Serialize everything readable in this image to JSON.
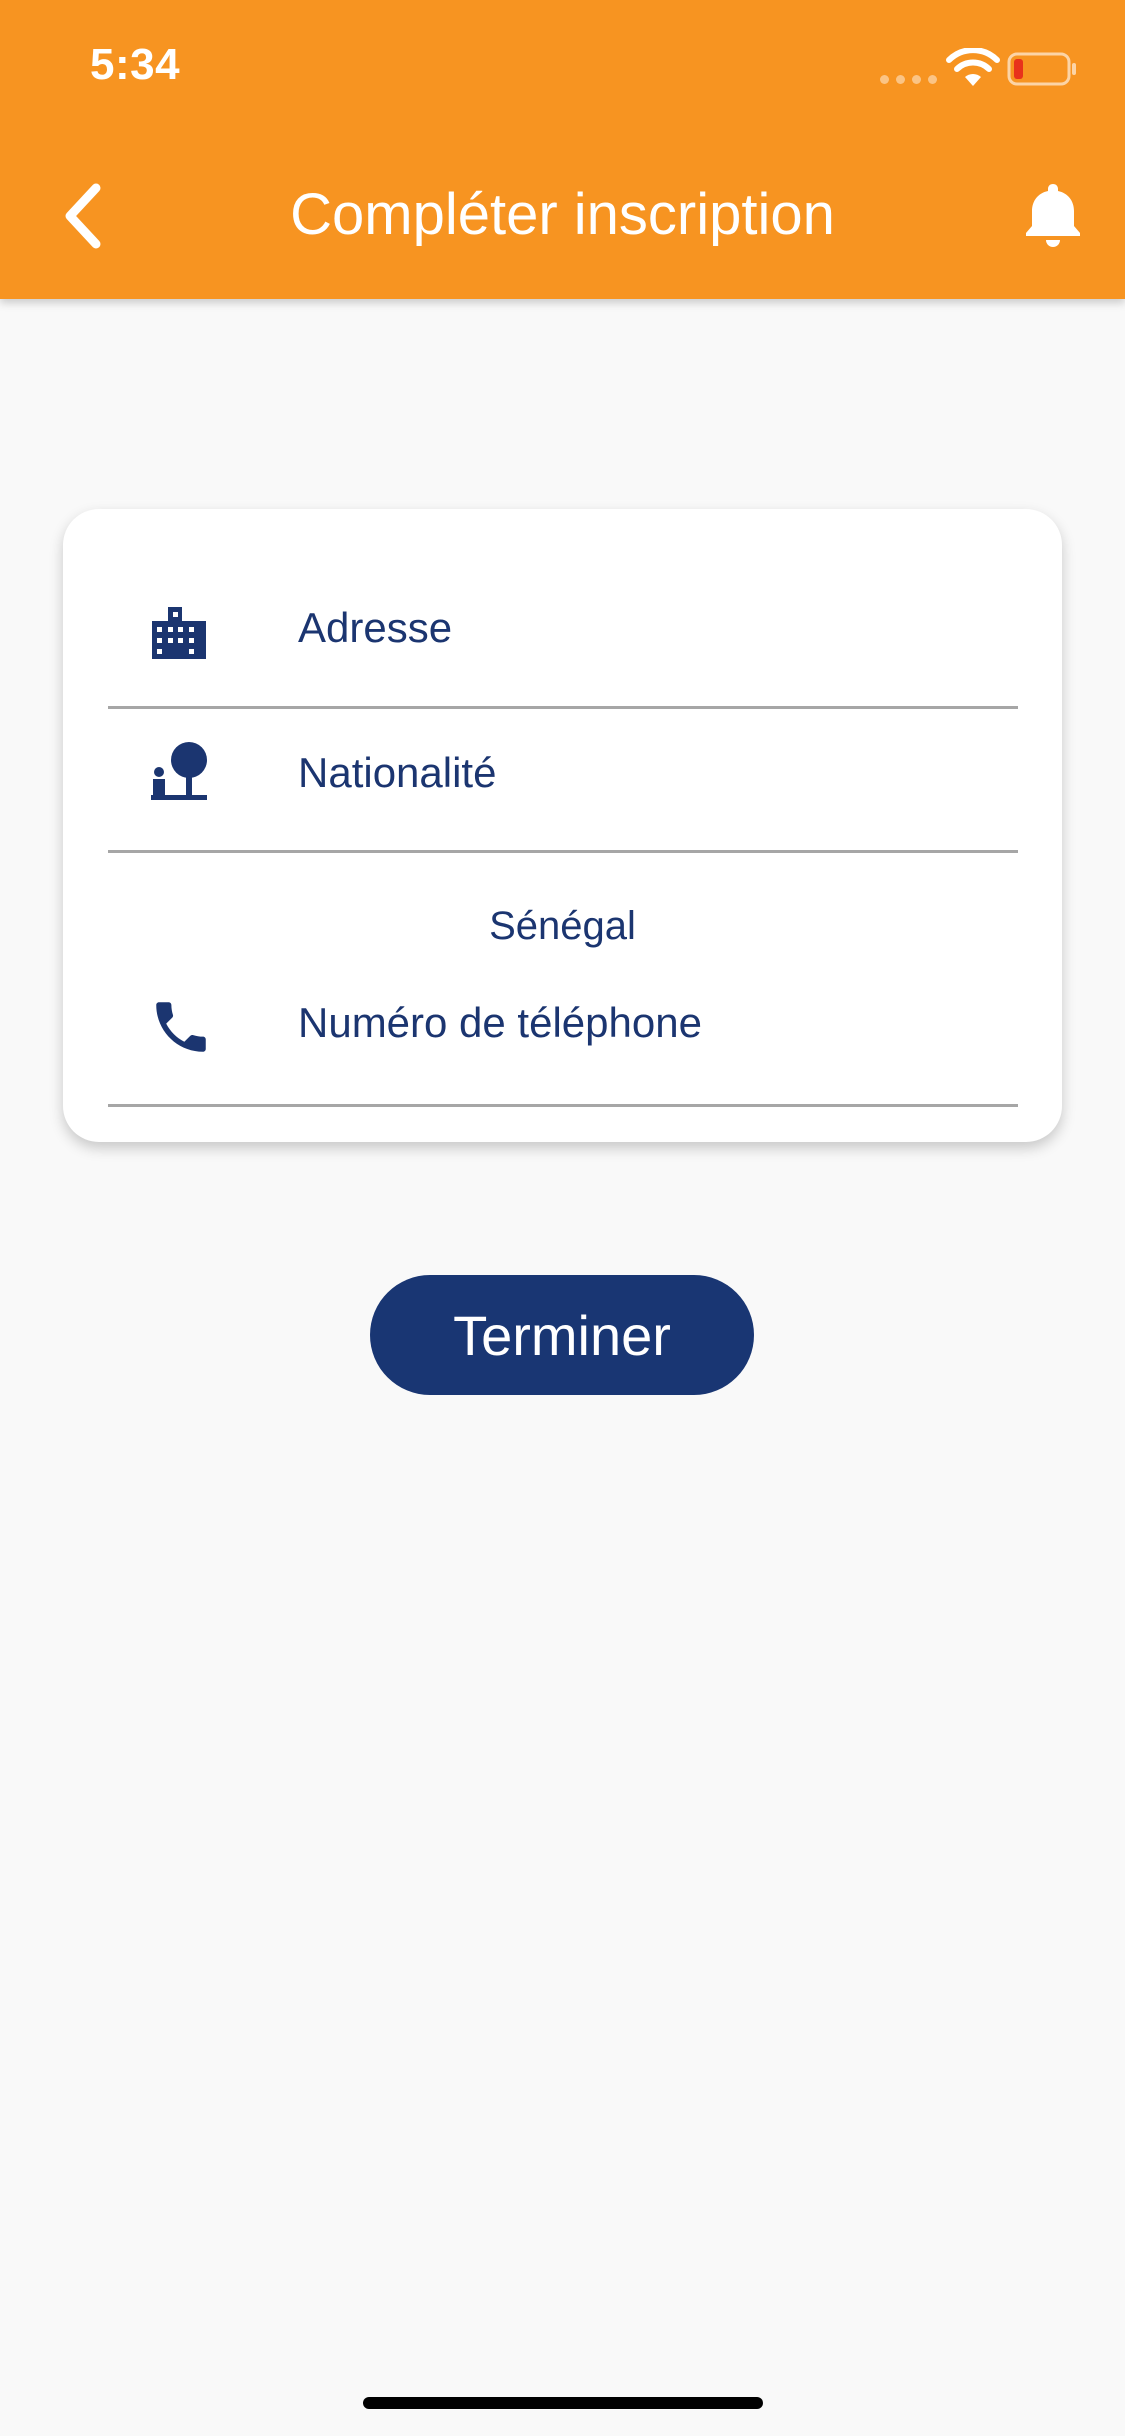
{
  "status_bar": {
    "time": "5:34"
  },
  "header": {
    "title": "Compléter inscription",
    "back_icon": "chevron-left-icon",
    "notification_icon": "bell-icon"
  },
  "form": {
    "fields": [
      {
        "icon": "building-icon",
        "label": "Adresse"
      },
      {
        "icon": "park-bench-icon",
        "label": "Nationalité"
      },
      {
        "icon": "phone-icon",
        "label": "Numéro de téléphone",
        "country": "Sénégal"
      }
    ]
  },
  "actions": {
    "submit_label": "Terminer"
  },
  "colors": {
    "app_bar": "#f79421",
    "primary": "#193673",
    "text": "#1b3570",
    "background": "#f9f9f9",
    "divider": "#a6a6a6"
  }
}
